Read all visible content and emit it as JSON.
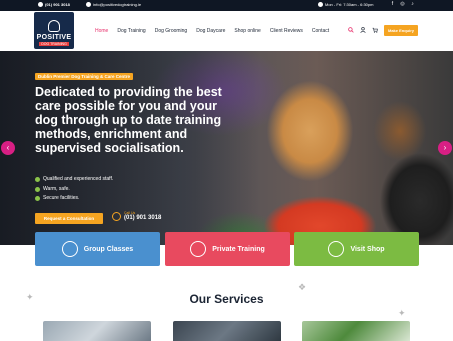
{
  "topbar": {
    "phone": "(01) 901 3018",
    "email": "info@positivedogtraining.ie",
    "hours": "Mon - Fri: 7:30am - 6:30pm",
    "social": [
      "facebook-icon",
      "instagram-icon",
      "tiktok-icon"
    ]
  },
  "header": {
    "logo_line1": "POSITIVE",
    "logo_line2": "DOG TRAINING",
    "nav": [
      "Home",
      "Dog Training",
      "Dog Grooming",
      "Dog Daycare",
      "Shop online",
      "Client Reviews",
      "Contact"
    ],
    "active_nav": "Home",
    "enquiry_button": "Make Enquiry"
  },
  "hero": {
    "tag": "Dublin Premier Dog Training & Care Centre",
    "headline": "Dedicated to providing the best care possible for you and your dog through up to date training methods, enrichment and supervised socialisation.",
    "bullets": [
      "Qualified and experienced staff.",
      "Warm, safe.",
      "Secure facilities."
    ],
    "cta_button": "Request a Consultation",
    "call_label": "Call Us",
    "call_number": "(01) 901 3018"
  },
  "features": [
    {
      "label": "Group Classes",
      "icon": "dog-group-icon",
      "color": "#4a90cf"
    },
    {
      "label": "Private Training",
      "icon": "handshake-icon",
      "color": "#e84a5f"
    },
    {
      "label": "Visit Shop",
      "icon": "shop-icon",
      "color": "#7cbb42"
    }
  ],
  "services": {
    "title": "Our Services"
  },
  "colors": {
    "accent": "#f5a421",
    "nav_active": "#e8336e",
    "slider_arrows": "#d81f84",
    "dark": "#0f1724"
  }
}
